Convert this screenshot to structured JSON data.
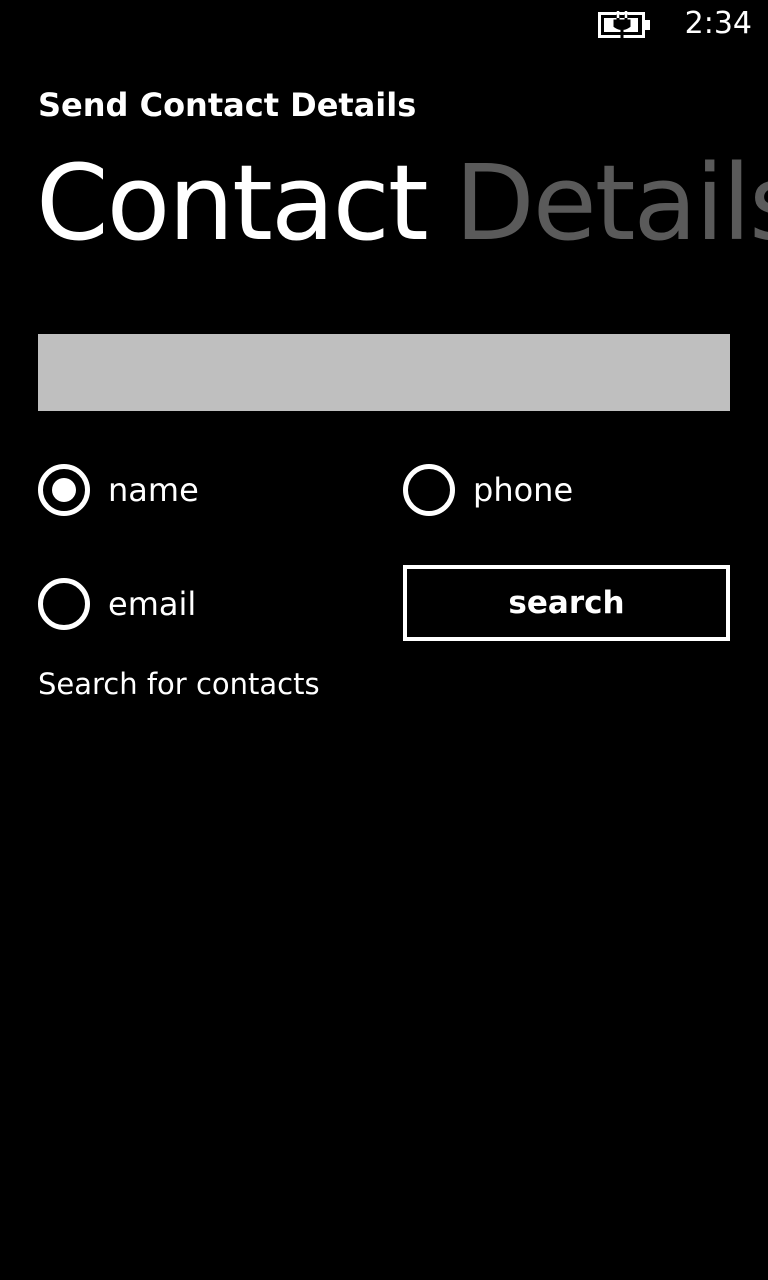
{
  "status_bar": {
    "time": "2:34",
    "battery_icon": "battery-charging-icon"
  },
  "app": {
    "title": "Send Contact Details"
  },
  "pivot": {
    "items": [
      {
        "label": "Contact",
        "active": true
      },
      {
        "label": "Details",
        "active": false
      }
    ]
  },
  "search": {
    "value": "",
    "placeholder": ""
  },
  "search_options": {
    "selected": "name",
    "name_label": "name",
    "phone_label": "phone",
    "email_label": "email"
  },
  "actions": {
    "search_label": "search"
  },
  "status": {
    "message": "Search for contacts"
  },
  "colors": {
    "background": "#000000",
    "foreground": "#ffffff",
    "inactive_header": "#5a5a5a",
    "textbox": "#bfbfbf"
  }
}
